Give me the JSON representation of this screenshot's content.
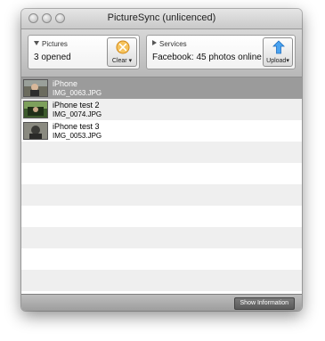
{
  "window": {
    "title": "PictureSync (unlicenced)"
  },
  "pictures": {
    "header": "Pictures",
    "value": "3 opened",
    "clear_label": "Clear ▾"
  },
  "services": {
    "header": "Services",
    "value": "Facebook: 45 photos online",
    "upload_label": "Upload▾"
  },
  "files": [
    {
      "name": "iPhone",
      "file": "IMG_0063.JPG",
      "selected": true
    },
    {
      "name": "iPhone test 2",
      "file": "IMG_0074.JPG",
      "selected": false
    },
    {
      "name": "iPhone test 3",
      "file": "IMG_0053.JPG",
      "selected": false
    }
  ],
  "footer": {
    "show_info_label": "Show Information"
  },
  "colors": {
    "selection": "#9b9b9b",
    "clear_icon": "#f0a830",
    "upload_icon": "#3a8ee0"
  },
  "icons": [
    "close-button",
    "minimize-button",
    "zoom-button",
    "clear-icon",
    "upload-icon"
  ]
}
